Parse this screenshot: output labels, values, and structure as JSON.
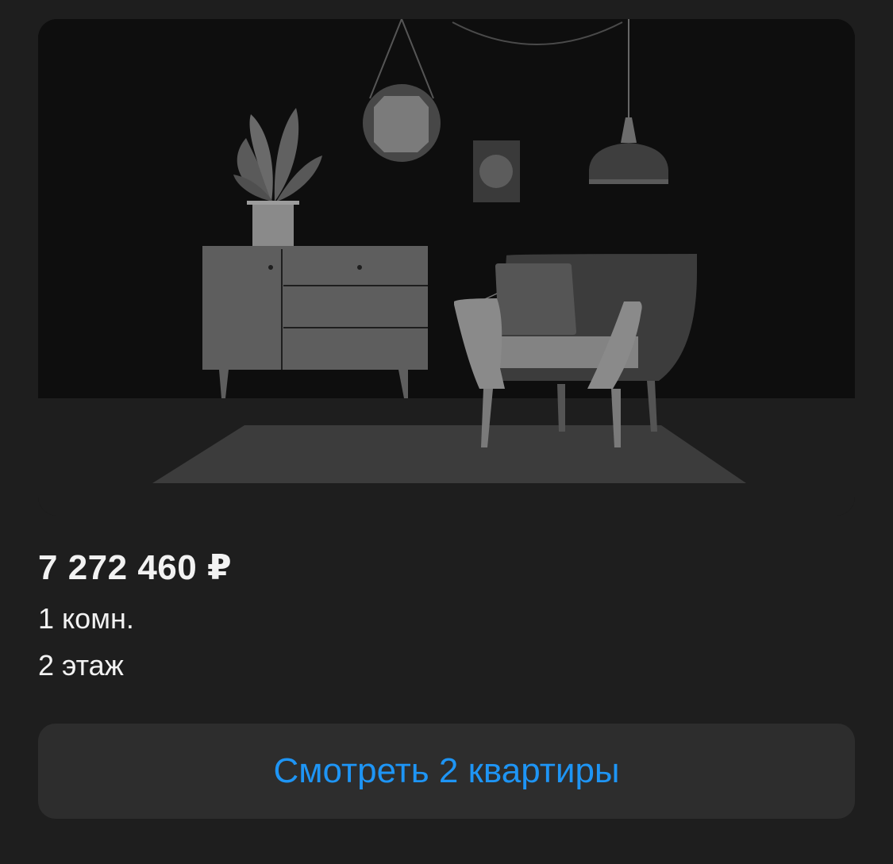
{
  "listing": {
    "price": "7 272 460 ₽",
    "rooms": "1 комн.",
    "floor": "2 этаж"
  },
  "actions": {
    "view_button_label": "Смотреть 2 квартиры"
  },
  "colors": {
    "background": "#1e1e1e",
    "button_background": "#2d2d2d",
    "accent_link": "#1e95f5",
    "text_primary": "#f2f2f2"
  },
  "icons": [
    "interior-placeholder-illustration"
  ]
}
